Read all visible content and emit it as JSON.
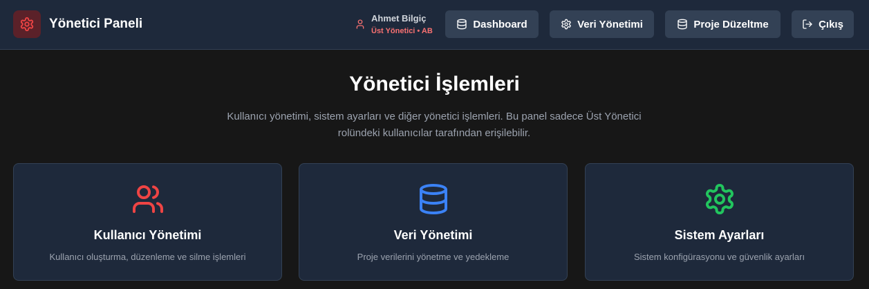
{
  "app": {
    "title": "Yönetici Paneli",
    "icon": "gear-icon",
    "accent_color": "#ef4444"
  },
  "user": {
    "name": "Ahmet Bilgiç",
    "role": "Üst Yönetici • AB",
    "icon": "user-icon"
  },
  "nav": [
    {
      "label": "Dashboard",
      "icon": "database-icon"
    },
    {
      "label": "Veri Yönetimi",
      "icon": "gear-icon"
    },
    {
      "label": "Proje Düzeltme",
      "icon": "database-icon"
    },
    {
      "label": "Çıkış",
      "icon": "logout-icon"
    }
  ],
  "main": {
    "heading": "Yönetici İşlemleri",
    "description": "Kullanıcı yönetimi, sistem ayarları ve diğer yönetici işlemleri. Bu panel sadece Üst Yönetici rolündeki kullanıcılar tarafından erişilebilir."
  },
  "cards": [
    {
      "title": "Kullanıcı Yönetimi",
      "description": "Kullanıcı oluşturma, düzenleme ve silme işlemleri",
      "icon": "users-icon",
      "color": "#ef4444"
    },
    {
      "title": "Veri Yönetimi",
      "description": "Proje verilerini yönetme ve yedekleme",
      "icon": "database-icon",
      "color": "#3b82f6"
    },
    {
      "title": "Sistem Ayarları",
      "description": "Sistem konfigürasyonu ve güvenlik ayarları",
      "icon": "settings-icon",
      "color": "#22c55e"
    }
  ]
}
